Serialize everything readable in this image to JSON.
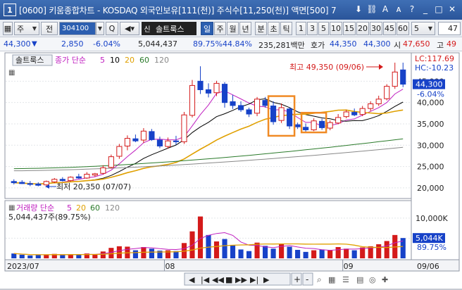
{
  "window": {
    "number": "1",
    "title": "[0600] 키움종합차트 - KOSDAQ 외국인보유[111(천)] 주식수[11,250(천)] 액면[500] 7",
    "icons": [
      "download-icon",
      "link-icon",
      "text-icon",
      "font-icon",
      "question-icon",
      "minimize-icon",
      "maximize-icon",
      "close-icon"
    ]
  },
  "toolbar": {
    "type_label": "주",
    "all_label": "전",
    "code_value": "304100",
    "search_symbol": "Q",
    "new_label": "신",
    "name_value": "솔트룩스",
    "periods": [
      "일",
      "주",
      "월",
      "년",
      "분",
      "초",
      "틱"
    ],
    "selected_period": "일",
    "intervals": [
      "1",
      "3",
      "5",
      "10",
      "15",
      "20",
      "30",
      "45",
      "60"
    ],
    "interval_select": "5",
    "count_value": "47"
  },
  "info": {
    "price": "44,300",
    "down_arrow": "▼",
    "change": "2,850",
    "change_pct": "-6.04%",
    "volume": "5,044,437",
    "ratio1": "89.75%",
    "ratio2": "44.84%",
    "amount": "235,281백만",
    "quote_label": "호가",
    "bid": "44,350",
    "ask": "44,300",
    "open_label": "시",
    "open": "47,650",
    "high_label": "고",
    "high": "49"
  },
  "legend": {
    "name": "솔트룩스",
    "series_label": "종가 단순",
    "ma": [
      "5",
      "10",
      "20",
      "60",
      "120"
    ],
    "ma_colors": [
      "#c020c0",
      "#000000",
      "#e0a000",
      "#2a7a2a",
      "#888888"
    ]
  },
  "volume_legend": {
    "label": "거래량 단순",
    "ma": [
      "5",
      "20",
      "60",
      "120"
    ],
    "value_text": "5,044,437주(89.75%)"
  },
  "annotations": {
    "high_text": "최고 49,350 (09/06)",
    "low_text": "최저 20,350 (07/07)"
  },
  "right_axis": {
    "lc": "LC:117.69",
    "hc": "HC:-10.23",
    "price_tag": "44,300",
    "price_pct": "-6.04%",
    "vol_tag": "5,044K",
    "vol_pct": "89.75%"
  },
  "chart_data": {
    "type": "candlestick",
    "y_ticks": [
      "45,000",
      "40,000",
      "35,000",
      "30,000",
      "25,000",
      "20,000"
    ],
    "y_tick_values": [
      45000,
      40000,
      35000,
      30000,
      25000,
      20000
    ],
    "ylim": [
      18000,
      51000
    ],
    "vol_ticks": [
      "10,000K",
      "5,000K"
    ],
    "vol_tick_values": [
      10000,
      5000
    ],
    "vol_ylim": [
      0,
      14000
    ],
    "x_labels": [
      "2023/07",
      "08",
      "09",
      "09/06"
    ],
    "x_label_index": [
      0,
      19,
      41,
      49
    ],
    "candles": [
      {
        "o": 21500,
        "h": 22000,
        "l": 20800,
        "c": 21200
      },
      {
        "o": 21300,
        "h": 21800,
        "l": 20900,
        "c": 21000
      },
      {
        "o": 21000,
        "h": 21600,
        "l": 20400,
        "c": 20800
      },
      {
        "o": 20900,
        "h": 21300,
        "l": 20350,
        "c": 20600
      },
      {
        "o": 20700,
        "h": 21700,
        "l": 20500,
        "c": 21500
      },
      {
        "o": 21400,
        "h": 22300,
        "l": 21100,
        "c": 22000
      },
      {
        "o": 22000,
        "h": 22500,
        "l": 21500,
        "c": 21700
      },
      {
        "o": 21700,
        "h": 22700,
        "l": 21500,
        "c": 22500
      },
      {
        "o": 22600,
        "h": 23300,
        "l": 22100,
        "c": 22300
      },
      {
        "o": 22300,
        "h": 23700,
        "l": 22100,
        "c": 23200
      },
      {
        "o": 23000,
        "h": 23500,
        "l": 22600,
        "c": 23300
      },
      {
        "o": 23400,
        "h": 25300,
        "l": 23100,
        "c": 24700
      },
      {
        "o": 24800,
        "h": 27800,
        "l": 24500,
        "c": 27300
      },
      {
        "o": 27400,
        "h": 30300,
        "l": 26800,
        "c": 29700
      },
      {
        "o": 29800,
        "h": 32300,
        "l": 28800,
        "c": 31600
      },
      {
        "o": 31500,
        "h": 32500,
        "l": 30700,
        "c": 31000
      },
      {
        "o": 31200,
        "h": 34000,
        "l": 30500,
        "c": 33300
      },
      {
        "o": 33200,
        "h": 33800,
        "l": 31000,
        "c": 31300
      },
      {
        "o": 31200,
        "h": 32000,
        "l": 29300,
        "c": 29800
      },
      {
        "o": 29700,
        "h": 31800,
        "l": 29200,
        "c": 31000
      },
      {
        "o": 31000,
        "h": 32200,
        "l": 30100,
        "c": 30800
      },
      {
        "o": 30800,
        "h": 37800,
        "l": 30300,
        "c": 37100
      },
      {
        "o": 37000,
        "h": 45300,
        "l": 36500,
        "c": 44000
      },
      {
        "o": 45000,
        "h": 48500,
        "l": 42000,
        "c": 43000
      },
      {
        "o": 43000,
        "h": 44500,
        "l": 41200,
        "c": 42200
      },
      {
        "o": 42300,
        "h": 45100,
        "l": 41500,
        "c": 44500
      },
      {
        "o": 44300,
        "h": 44800,
        "l": 38800,
        "c": 40000
      },
      {
        "o": 40200,
        "h": 41800,
        "l": 38500,
        "c": 39300
      },
      {
        "o": 39300,
        "h": 40300,
        "l": 37800,
        "c": 38300
      },
      {
        "o": 38300,
        "h": 38800,
        "l": 36600,
        "c": 37300
      },
      {
        "o": 37500,
        "h": 41300,
        "l": 36800,
        "c": 40800
      },
      {
        "o": 40500,
        "h": 41300,
        "l": 38800,
        "c": 39300
      },
      {
        "o": 39200,
        "h": 40300,
        "l": 34800,
        "c": 35500
      },
      {
        "o": 35800,
        "h": 39800,
        "l": 35200,
        "c": 38800
      },
      {
        "o": 38500,
        "h": 38800,
        "l": 33800,
        "c": 34500
      },
      {
        "o": 34800,
        "h": 35300,
        "l": 33800,
        "c": 34300
      },
      {
        "o": 34200,
        "h": 35100,
        "l": 33100,
        "c": 33600
      },
      {
        "o": 33600,
        "h": 36300,
        "l": 33300,
        "c": 35700
      },
      {
        "o": 35600,
        "h": 36200,
        "l": 33600,
        "c": 34100
      },
      {
        "o": 34000,
        "h": 35800,
        "l": 33500,
        "c": 35300
      },
      {
        "o": 35200,
        "h": 37300,
        "l": 34900,
        "c": 36500
      },
      {
        "o": 36700,
        "h": 38300,
        "l": 36300,
        "c": 37800
      },
      {
        "o": 37700,
        "h": 38600,
        "l": 36800,
        "c": 37100
      },
      {
        "o": 37200,
        "h": 39200,
        "l": 36800,
        "c": 38600
      },
      {
        "o": 38600,
        "h": 40300,
        "l": 38000,
        "c": 39700
      },
      {
        "o": 39700,
        "h": 41600,
        "l": 39200,
        "c": 40800
      },
      {
        "o": 40900,
        "h": 44300,
        "l": 40500,
        "c": 43800
      },
      {
        "o": 43800,
        "h": 49350,
        "l": 43200,
        "c": 47150
      },
      {
        "o": 47650,
        "h": 49350,
        "l": 43600,
        "c": 44300
      }
    ],
    "volume": [
      1200,
      900,
      700,
      800,
      900,
      1100,
      800,
      1000,
      900,
      1200,
      1000,
      1700,
      2600,
      3000,
      2900,
      2000,
      2800,
      2400,
      1900,
      2000,
      1800,
      3800,
      6700,
      10400,
      5800,
      4200,
      4800,
      3300,
      2200,
      1800,
      3900,
      3100,
      2400,
      3600,
      2900,
      2100,
      1600,
      2000,
      2200,
      2100,
      2800,
      2400,
      2000,
      2700,
      3000,
      3500,
      4300,
      5800,
      5044
    ],
    "vol_colors": [
      "b",
      "b",
      "b",
      "b",
      "r",
      "r",
      "b",
      "r",
      "b",
      "r",
      "r",
      "r",
      "r",
      "r",
      "r",
      "b",
      "r",
      "b",
      "b",
      "r",
      "b",
      "r",
      "r",
      "r",
      "b",
      "r",
      "b",
      "b",
      "b",
      "b",
      "r",
      "b",
      "b",
      "r",
      "b",
      "b",
      "b",
      "r",
      "b",
      "r",
      "r",
      "r",
      "b",
      "r",
      "r",
      "r",
      "r",
      "r",
      "b"
    ]
  },
  "bottom": {
    "nav_buttons": [
      "◀",
      "|◀",
      "◀◀",
      "■",
      "▶▶",
      "▶|",
      "▶"
    ],
    "tools": [
      "+",
      "-",
      "zoom",
      "grid",
      "list",
      "ruler",
      "circle",
      "cross"
    ]
  }
}
